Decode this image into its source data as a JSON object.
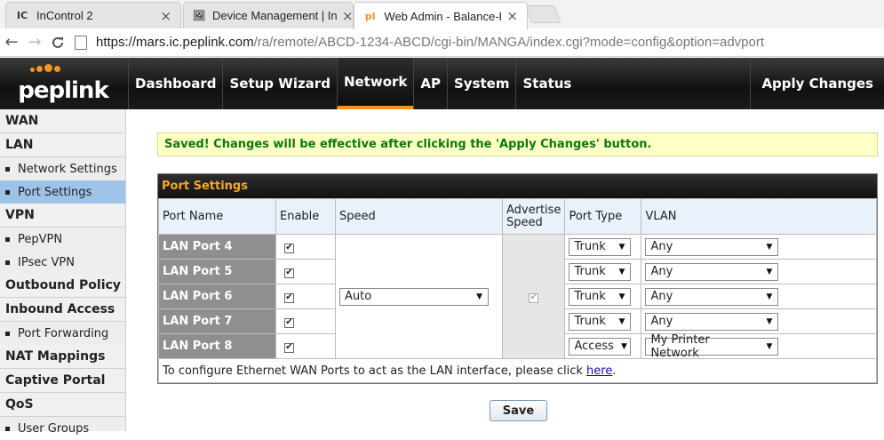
{
  "browser": {
    "tabs": [
      {
        "favicon": "IC",
        "title": "InControl 2",
        "close": "×"
      },
      {
        "favicon": "🖼",
        "title": "Device Management | In",
        "close": "×"
      },
      {
        "favicon": "pl",
        "title": "Web Admin - Balance-Ro",
        "close": "×"
      }
    ],
    "nav": {
      "back": "←",
      "forward": "→",
      "reload": "C"
    },
    "url_host": "https://mars.ic.peplink.com",
    "url_path": "/ra/remote/ABCD-1234-ABCD/cgi-bin/MANGA/index.cgi?mode=config&option=advport"
  },
  "header": {
    "logo_text": "peplink",
    "nav": [
      "Dashboard",
      "Setup Wizard",
      "Network",
      "AP",
      "System",
      "Status"
    ],
    "active_nav": "Network",
    "apply_label": "Apply Changes"
  },
  "sidebar": {
    "sections": [
      {
        "label": "WAN",
        "items": []
      },
      {
        "label": "LAN",
        "items": [
          "Network Settings",
          "Port Settings"
        ]
      },
      {
        "label": "VPN",
        "items": [
          "PepVPN",
          "IPsec VPN"
        ]
      },
      {
        "label": "Outbound Policy",
        "items": []
      },
      {
        "label": "Inbound Access",
        "items": [
          "Port Forwarding"
        ]
      },
      {
        "label": "NAT Mappings",
        "items": []
      },
      {
        "label": "Captive Portal",
        "items": []
      },
      {
        "label": "QoS",
        "items": [
          "User Groups"
        ]
      }
    ],
    "active_item": "Port Settings"
  },
  "main": {
    "saved_message": "Saved! Changes will be effective after clicking the 'Apply Changes' button.",
    "port_settings": {
      "title": "Port Settings",
      "columns": [
        "Port Name",
        "Enable",
        "Speed",
        "Advertise Speed",
        "Port Type",
        "VLAN"
      ],
      "speed": "Auto",
      "advertise_speed_checked": true,
      "rows": [
        {
          "name": "LAN Port 4",
          "enabled": true,
          "type": "Trunk",
          "vlan": "Any"
        },
        {
          "name": "LAN Port 5",
          "enabled": true,
          "type": "Trunk",
          "vlan": "Any"
        },
        {
          "name": "LAN Port 6",
          "enabled": true,
          "type": "Trunk",
          "vlan": "Any"
        },
        {
          "name": "LAN Port 7",
          "enabled": true,
          "type": "Trunk",
          "vlan": "Any"
        },
        {
          "name": "LAN Port 8",
          "enabled": true,
          "type": "Access",
          "vlan": "My Printer Network"
        }
      ],
      "footnote_text": "To configure Ethernet WAN Ports to act as the LAN interface, please click ",
      "footnote_link": "here",
      "footnote_end": "."
    },
    "save_label": "Save"
  },
  "colors": {
    "accent": "#f7941d",
    "saved_text": "#0a7a0a",
    "active_sidebar": "#9ec3e8"
  }
}
